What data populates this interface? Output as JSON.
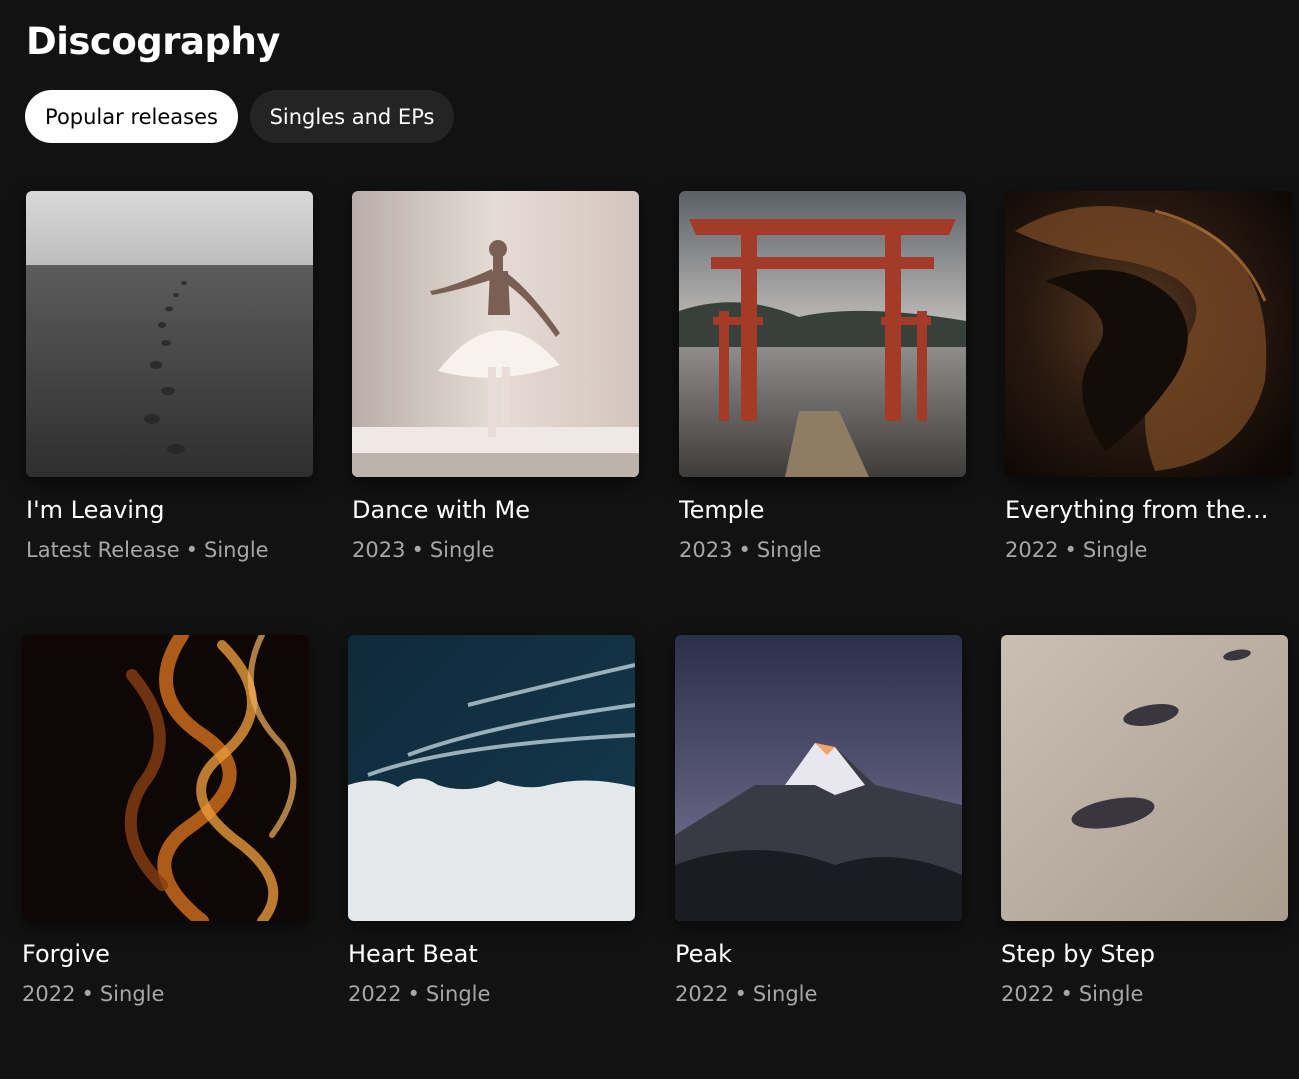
{
  "section": {
    "title": "Discography"
  },
  "filters": {
    "popular_label": "Popular releases",
    "singles_label": "Singles and EPs"
  },
  "releases": [
    {
      "title": "I'm Leaving",
      "year": "Latest Release",
      "type": "Single",
      "art": "beach-footprints-icon"
    },
    {
      "title": "Dance with Me",
      "year": "2023",
      "type": "Single",
      "art": "ballerina-icon"
    },
    {
      "title": "Temple",
      "year": "2023",
      "type": "Single",
      "art": "torii-gate-icon"
    },
    {
      "title": "Everything from the...",
      "year": "2022",
      "type": "Single",
      "art": "dark-swirl-icon"
    },
    {
      "title": "Forgive",
      "year": "2022",
      "type": "Single",
      "art": "fire-smoke-icon"
    },
    {
      "title": "Heart Beat",
      "year": "2022",
      "type": "Single",
      "art": "ocean-shore-icon"
    },
    {
      "title": "Peak",
      "year": "2022",
      "type": "Single",
      "art": "mountain-peak-icon"
    },
    {
      "title": "Step by Step",
      "year": "2022",
      "type": "Single",
      "art": "sand-footprints-icon"
    }
  ],
  "separator": "•",
  "colors": {
    "background": "#121212",
    "chip_active_bg": "#ffffff",
    "chip_inactive_bg": "#242424",
    "meta_text": "#a7a7a7"
  }
}
